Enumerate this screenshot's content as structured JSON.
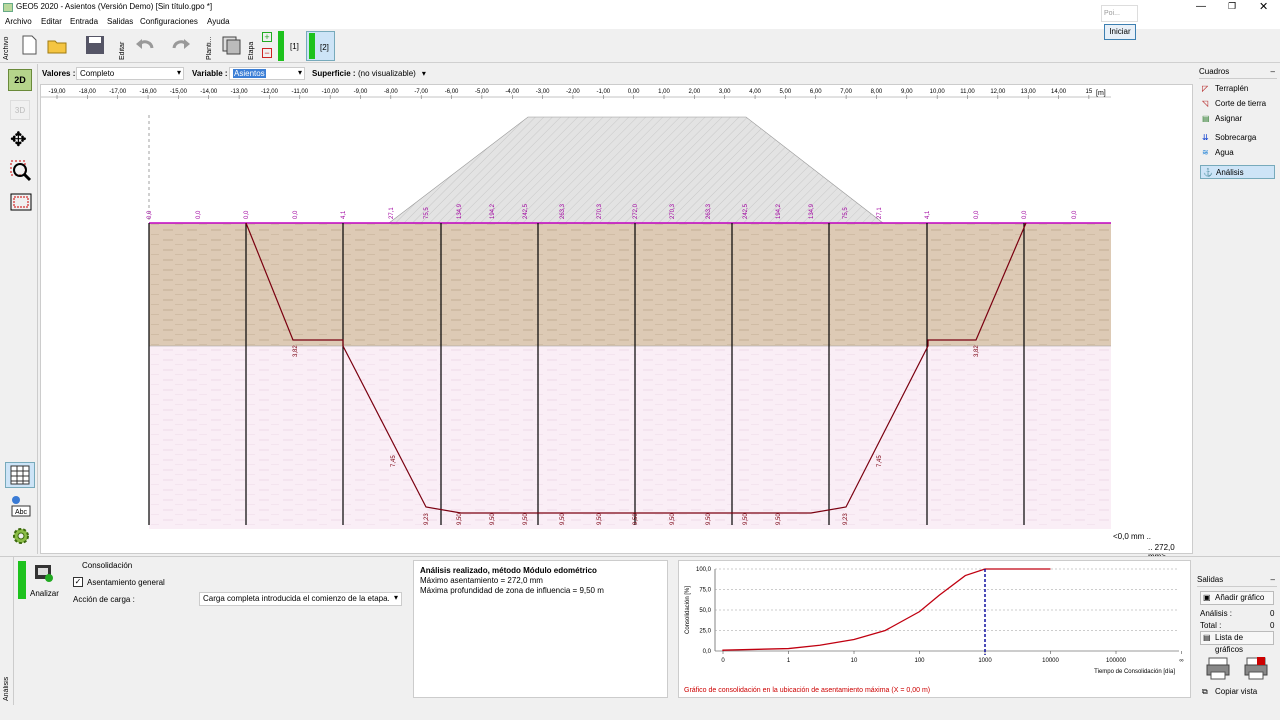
{
  "window": {
    "title": "GEO5 2020 - Asientos (Versión Demo) [Sin título.gpo *]"
  },
  "menu": [
    "Archivo",
    "Editar",
    "Entrada",
    "Salidas",
    "Configuraciones",
    "Ayuda"
  ],
  "toolbar": {
    "archivo": "Archivo",
    "editar": "Editar",
    "plantilla": "Planti...",
    "etapa": "Etapa",
    "stage1": "[1]",
    "stage2": "[2]"
  },
  "popup": {
    "title": "Poi...",
    "button": "Iniciar"
  },
  "options": {
    "valores_label": "Valores :",
    "valores_value": "Completo",
    "variable_label": "Variable :",
    "variable_value": "Asientos",
    "superficie_label": "Superficie :",
    "superficie_value": "(no visualizable)"
  },
  "ruler": {
    "ticks": [
      "-19,00",
      "-18,00",
      "-17,00",
      "-16,00",
      "-15,00",
      "-14,00",
      "-13,00",
      "-12,00",
      "-11,00",
      "-10,00",
      "-9,00",
      "-8,00",
      "-7,00",
      "-6,00",
      "-5,00",
      "-4,00",
      "-3,00",
      "-2,00",
      "-1,00",
      "0,00",
      "1,00",
      "2,00",
      "3,00",
      "4,00",
      "5,00",
      "6,00",
      "7,00",
      "8,00",
      "9,00",
      "10,00",
      "11,00",
      "12,00",
      "13,00",
      "14,00",
      "15"
    ],
    "unit": "[m]"
  },
  "drawing": {
    "top_values": [
      "0,0",
      "0,0",
      "0,0",
      "0,0",
      "4,1",
      "27,1",
      "75,5",
      "134,9",
      "194,2",
      "242,5",
      "263,3",
      "270,3",
      "272,0",
      "270,3",
      "263,3",
      "242,5",
      "194,2",
      "134,9",
      "75,5",
      "27,1",
      "4,1",
      "0,0",
      "0,0",
      "0,0"
    ],
    "mid_values": [
      "3,82",
      "3,82"
    ],
    "bottom_values": [
      "9,23",
      "9,50",
      "9,50",
      "9,50",
      "9,50",
      "9,50",
      "9,50",
      "9,50",
      "9,50",
      "9,50",
      "9,50",
      "9,23"
    ],
    "side_values": [
      "7,45",
      "7,45"
    ],
    "legend_min": "<0,0 mm ..",
    "legend_max": ".. 272,0 mm>"
  },
  "cuadros": {
    "title": "Cuadros",
    "items": [
      "Terraplén",
      "Corte de tierra",
      "Asignar",
      "Sobrecarga",
      "Agua",
      "Análisis"
    ],
    "active": "Análisis"
  },
  "salidas": {
    "title": "Salidas",
    "add": "Añadir gráfico",
    "analisis_label": "Análisis :",
    "analisis_value": "0",
    "total_label": "Total :",
    "total_value": "0",
    "list": "Lista de gráficos",
    "copy": "Copiar vista"
  },
  "analysis": {
    "tab": "Análisis",
    "analyze_button": "Analizar",
    "group": "Consolidación",
    "checkbox": "Asentamiento general",
    "action_label": "Acción de carga :",
    "action_value": "Carga completa introducida el comienzo de la etapa."
  },
  "results": {
    "title": "Análisis realizado, método Módulo edométrico",
    "line1": "Máximo asentamiento = 272,0 mm",
    "line2": "Máxima profundidad de zona de influencia = 9,50 m"
  },
  "chart_data": {
    "type": "line",
    "ylabel": "Consolidación [%]",
    "xlabel": "Tiempo de Consolidación [día]",
    "x_ticks": [
      "0",
      "1",
      "10",
      "100",
      "1000",
      "10000",
      "100000",
      "∞"
    ],
    "y_ticks": [
      "100,0",
      "75,0",
      "50,0",
      "25,0",
      "0,0"
    ],
    "series": [
      {
        "x": [
          0.1,
          1,
          10,
          30,
          100,
          300,
          1000,
          2000,
          5000,
          10000,
          100000
        ],
        "values": [
          0,
          1,
          3,
          7,
          14,
          25,
          48,
          68,
          92,
          100,
          100
        ]
      }
    ],
    "marker_x": 10000,
    "caption": "Gráfico de consolidación en la ubicación de asentamiento máxima  (X = 0,00 m)"
  }
}
